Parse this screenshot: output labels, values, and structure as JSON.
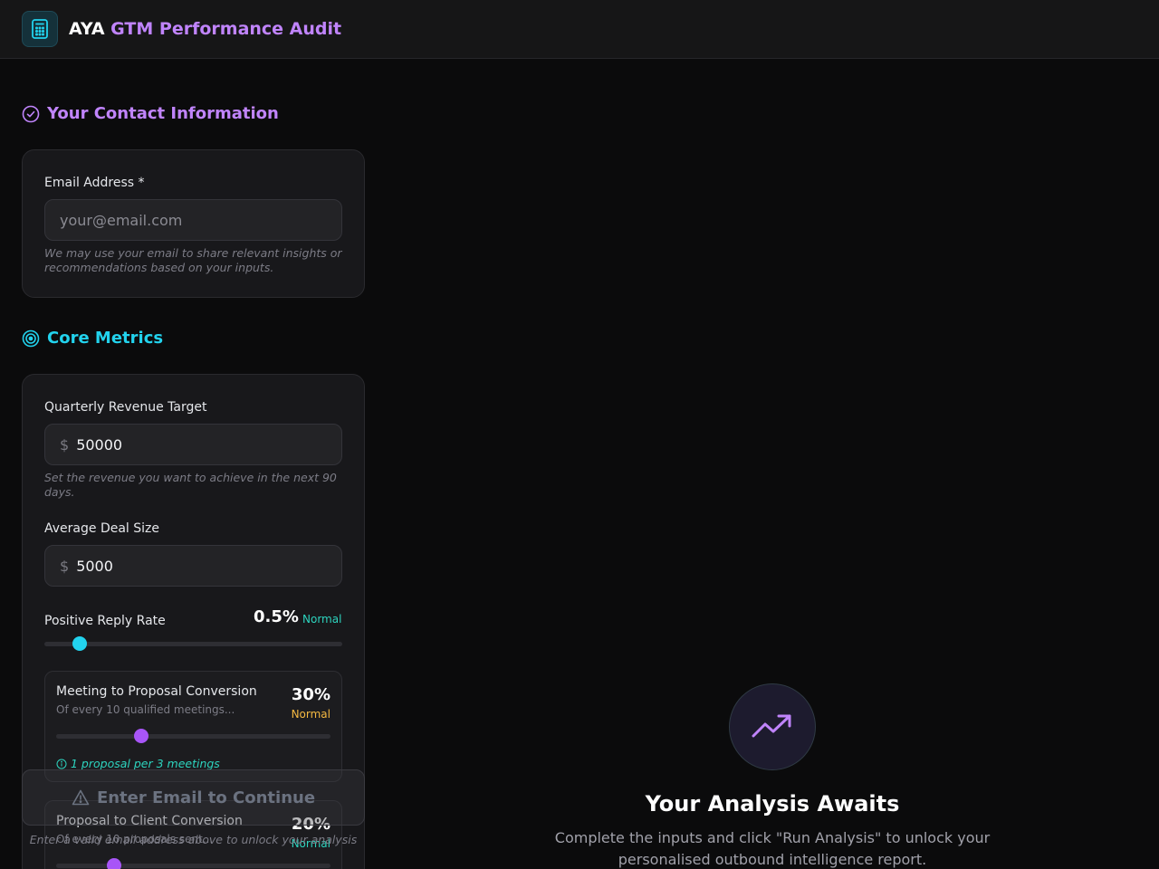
{
  "header": {
    "brand": "AYA",
    "title": "GTM Performance Audit",
    "logo_icon": "calculator-icon"
  },
  "contact": {
    "section_title": "Your Contact Information",
    "section_icon": "check-circle-icon",
    "email_label": "Email Address *",
    "email_placeholder": "your@email.com",
    "email_value": "",
    "email_hint": "We may use your email to share relevant insights or recommendations based on your inputs."
  },
  "metrics": {
    "section_title": "Core Metrics",
    "section_icon": "target-icon",
    "revenue": {
      "label": "Quarterly Revenue Target",
      "prefix": "$",
      "value": "50000",
      "hint": "Set the revenue you want to achieve in the next 90 days."
    },
    "deal_size": {
      "label": "Average Deal Size",
      "prefix": "$",
      "value": "5000"
    },
    "reply_rate": {
      "label": "Positive Reply Rate",
      "value_text": "0.5%",
      "status": "Normal",
      "status_color": "#2dd4bf",
      "level": 0.12,
      "thumb_color": "#22d3ee"
    },
    "meeting_to_proposal": {
      "label": "Meeting to Proposal Conversion",
      "sub": "Of every 10 qualified meetings...",
      "value_text": "30%",
      "status": "Normal",
      "status_color": "#f5b942",
      "level": 0.31,
      "thumb_color": "#a855f7",
      "note": "1 proposal per 3 meetings"
    },
    "proposal_to_client": {
      "label": "Proposal to Client Conversion",
      "sub": "Of every 10 proposals sent...",
      "value_text": "20%",
      "status": "Normal",
      "status_color": "#2dd4bf",
      "level": 0.21,
      "thumb_color": "#a855f7"
    }
  },
  "cta": {
    "label": "Enter Email to Continue",
    "icon": "warning-icon",
    "hint": "Enter a valid email address above to unlock your analysis"
  },
  "results": {
    "icon": "trending-up-icon",
    "title": "Your Analysis Awaits",
    "description": "Complete the inputs and click \"Run Analysis\" to unlock your personalised outbound intelligence report."
  }
}
